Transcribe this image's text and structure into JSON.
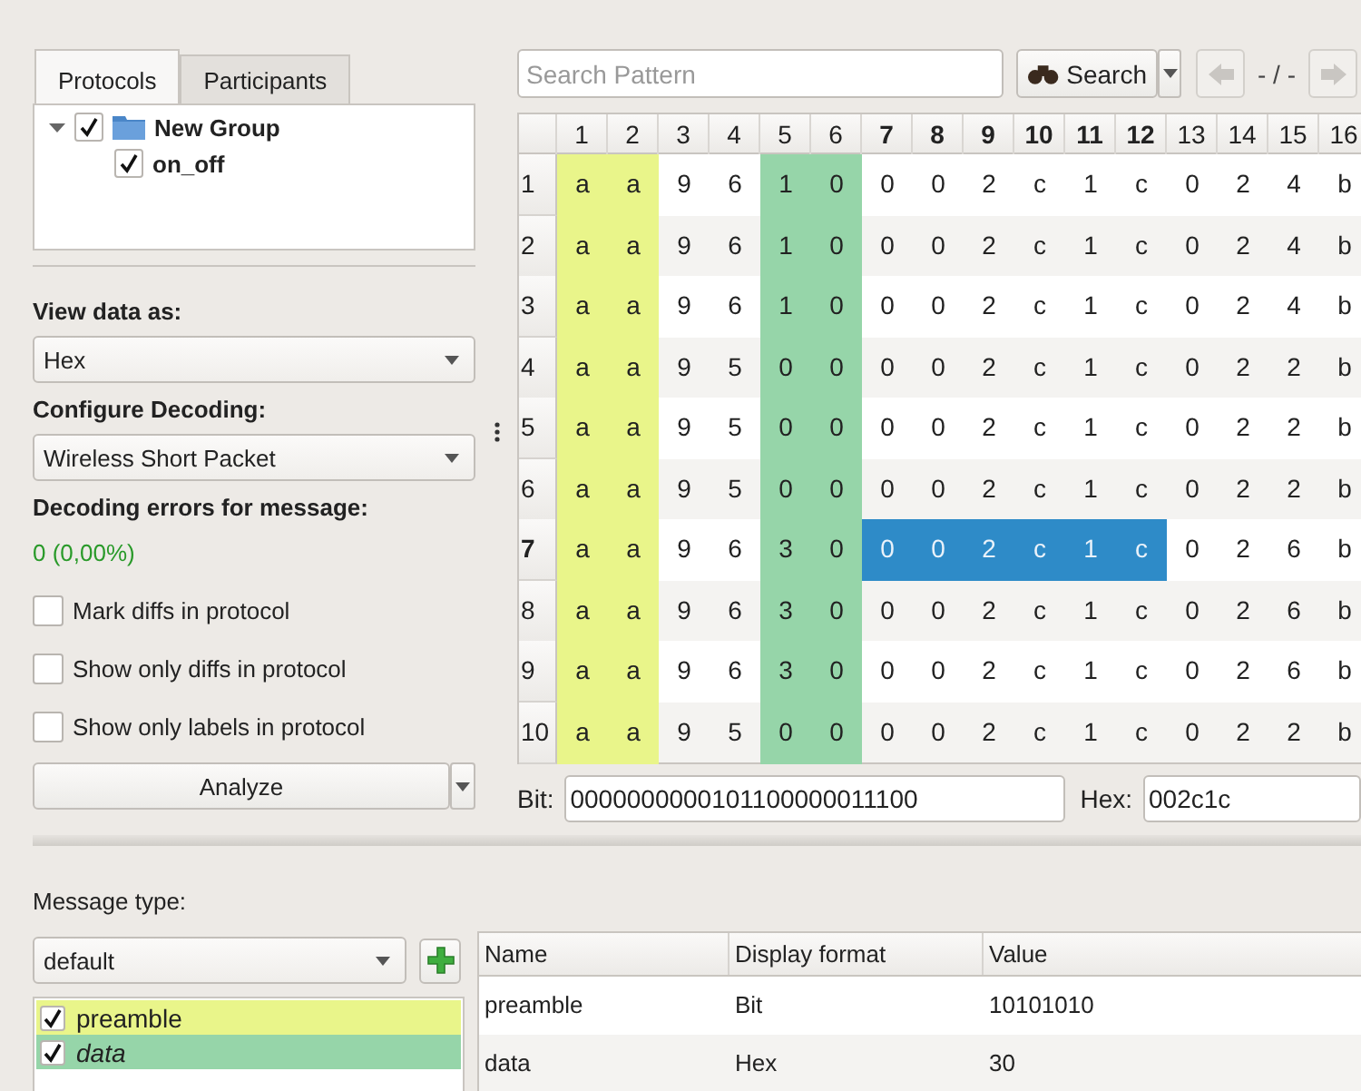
{
  "left_panel": {
    "tabs": [
      {
        "label": "Protocols",
        "selected": true
      },
      {
        "label": "Participants",
        "selected": false
      }
    ],
    "tree": [
      {
        "label": "New Group",
        "kind": "group",
        "checked": true,
        "expanded": true,
        "children": [
          {
            "label": "on_off",
            "checked": true
          }
        ]
      }
    ],
    "view_data_label": "View data as:",
    "view_data_value": "Hex",
    "decoding_label": "Configure Decoding:",
    "decoding_value": "Wireless Short Packet",
    "errors_label": "Decoding errors for message:",
    "errors_value": "0 (0,00%)",
    "options": [
      {
        "label": "Mark diffs in protocol",
        "checked": false
      },
      {
        "label": "Show only diffs in protocol",
        "checked": false
      },
      {
        "label": "Show only labels in protocol",
        "checked": false
      }
    ],
    "analyze_button": "Analyze"
  },
  "search": {
    "placeholder": "Search Pattern",
    "button": "Search",
    "position": "- / -"
  },
  "table": {
    "columns": [
      {
        "label": "1",
        "selected": false,
        "color": "#e9f58a"
      },
      {
        "label": "2",
        "selected": false,
        "color": "#e9f58a"
      },
      {
        "label": "3",
        "selected": false
      },
      {
        "label": "4",
        "selected": false
      },
      {
        "label": "5",
        "selected": false,
        "color": "#96d5a9"
      },
      {
        "label": "6",
        "selected": false,
        "color": "#96d5a9"
      },
      {
        "label": "7",
        "selected": true
      },
      {
        "label": "8",
        "selected": true
      },
      {
        "label": "9",
        "selected": true
      },
      {
        "label": "10",
        "selected": true
      },
      {
        "label": "11",
        "selected": true
      },
      {
        "label": "12",
        "selected": true
      },
      {
        "label": "13",
        "selected": false
      },
      {
        "label": "14",
        "selected": false
      },
      {
        "label": "15",
        "selected": false
      },
      {
        "label": "16",
        "selected": false
      }
    ],
    "rows": [
      {
        "header": "1",
        "selected": false,
        "cells": [
          "a",
          "a",
          "9",
          "6",
          "1",
          "0",
          "0",
          "0",
          "2",
          "c",
          "1",
          "c",
          "0",
          "2",
          "4",
          "b"
        ]
      },
      {
        "header": "2",
        "selected": false,
        "cells": [
          "a",
          "a",
          "9",
          "6",
          "1",
          "0",
          "0",
          "0",
          "2",
          "c",
          "1",
          "c",
          "0",
          "2",
          "4",
          "b"
        ]
      },
      {
        "header": "3",
        "selected": false,
        "cells": [
          "a",
          "a",
          "9",
          "6",
          "1",
          "0",
          "0",
          "0",
          "2",
          "c",
          "1",
          "c",
          "0",
          "2",
          "4",
          "b"
        ]
      },
      {
        "header": "4",
        "selected": false,
        "cells": [
          "a",
          "a",
          "9",
          "5",
          "0",
          "0",
          "0",
          "0",
          "2",
          "c",
          "1",
          "c",
          "0",
          "2",
          "2",
          "b"
        ]
      },
      {
        "header": "5",
        "selected": false,
        "cells": [
          "a",
          "a",
          "9",
          "5",
          "0",
          "0",
          "0",
          "0",
          "2",
          "c",
          "1",
          "c",
          "0",
          "2",
          "2",
          "b"
        ]
      },
      {
        "header": "6",
        "selected": false,
        "cells": [
          "a",
          "a",
          "9",
          "5",
          "0",
          "0",
          "0",
          "0",
          "2",
          "c",
          "1",
          "c",
          "0",
          "2",
          "2",
          "b"
        ]
      },
      {
        "header": "7",
        "selected": true,
        "cells": [
          "a",
          "a",
          "9",
          "6",
          "3",
          "0",
          "0",
          "0",
          "2",
          "c",
          "1",
          "c",
          "0",
          "2",
          "6",
          "b"
        ]
      },
      {
        "header": "8",
        "selected": false,
        "cells": [
          "a",
          "a",
          "9",
          "6",
          "3",
          "0",
          "0",
          "0",
          "2",
          "c",
          "1",
          "c",
          "0",
          "2",
          "6",
          "b"
        ]
      },
      {
        "header": "9",
        "selected": false,
        "cells": [
          "a",
          "a",
          "9",
          "6",
          "3",
          "0",
          "0",
          "0",
          "2",
          "c",
          "1",
          "c",
          "0",
          "2",
          "6",
          "b"
        ]
      },
      {
        "header": "10",
        "selected": false,
        "cells": [
          "a",
          "a",
          "9",
          "5",
          "0",
          "0",
          "0",
          "0",
          "2",
          "c",
          "1",
          "c",
          "0",
          "2",
          "2",
          "b"
        ]
      }
    ]
  },
  "selection": {
    "bit_label": "Bit:",
    "bit_value": "0000000000101100000011100",
    "hex_label": "Hex:",
    "hex_value": "002c1c"
  },
  "message_type": {
    "label": "Message type:",
    "value": "default",
    "labels": [
      {
        "name": "preamble",
        "checked": true,
        "color": "#e9f58a",
        "italic": false
      },
      {
        "name": "data",
        "checked": true,
        "color": "#96d5a9",
        "italic": true
      }
    ],
    "columns": [
      "Name",
      "Display format",
      "Value"
    ],
    "rows": [
      [
        "preamble",
        "Bit",
        "10101010"
      ],
      [
        "data",
        "Hex",
        "30"
      ]
    ]
  }
}
